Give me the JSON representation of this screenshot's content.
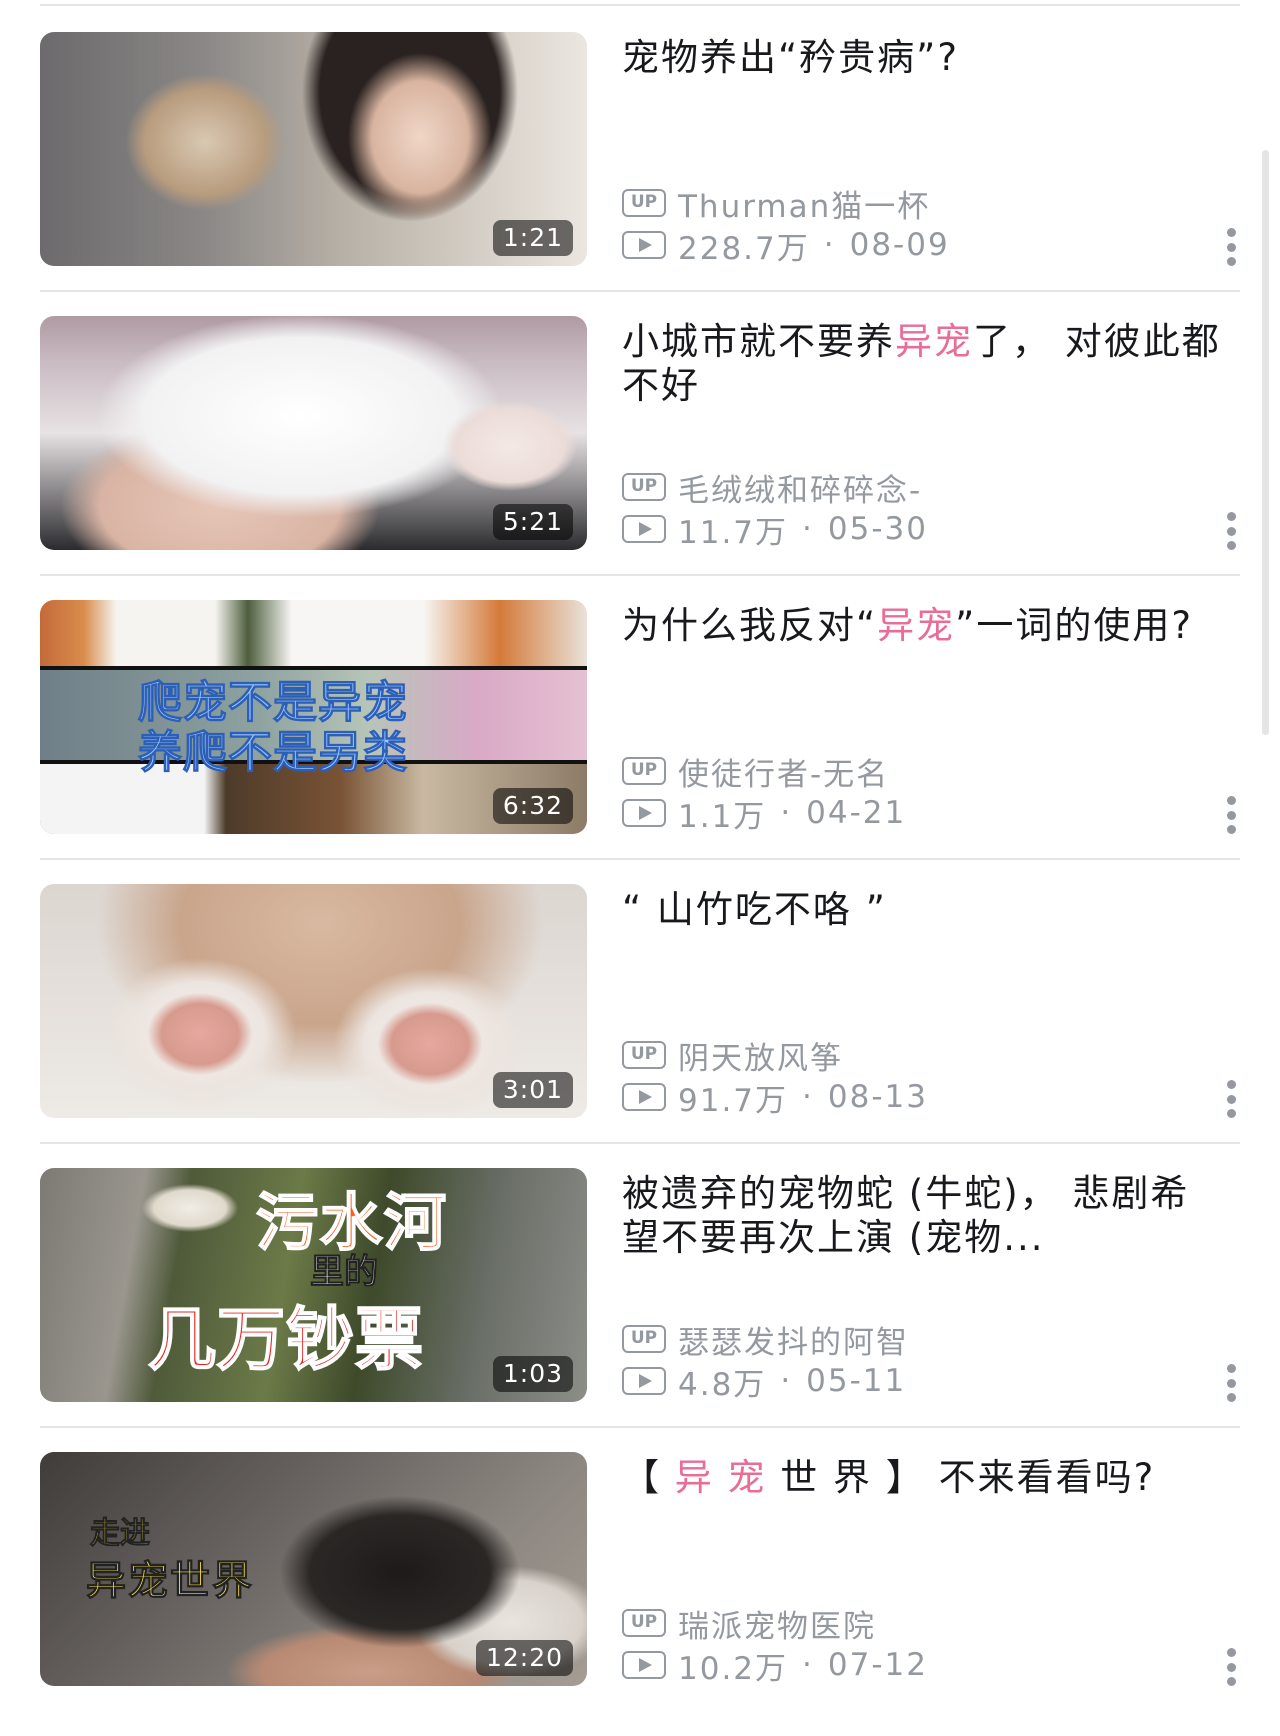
{
  "videos": [
    {
      "title_parts": [
        {
          "text": "宠物养出“矜贵病”?",
          "hl": false
        }
      ],
      "author": "Thurman猫一杯",
      "views": "228.7万",
      "date": "08-09",
      "duration": "1:21",
      "thumb_text": []
    },
    {
      "title_parts": [
        {
          "text": "小城市就不要养",
          "hl": false
        },
        {
          "text": "异宠",
          "hl": true
        },
        {
          "text": "了， 对彼此都不好",
          "hl": false
        }
      ],
      "author": "毛绒绒和碎碎念-",
      "views": "11.7万",
      "date": "05-30",
      "duration": "5:21",
      "thumb_text": []
    },
    {
      "title_parts": [
        {
          "text": "为什么我反对“",
          "hl": false
        },
        {
          "text": "异宠",
          "hl": true
        },
        {
          "text": "”一词的使用?",
          "hl": false
        }
      ],
      "author": "使徒行者-无名",
      "views": "1.1万",
      "date": "04-21",
      "duration": "6:32",
      "thumb_text": [
        "爬宠不是异宠",
        "养爬不是另类"
      ]
    },
    {
      "title_parts": [
        {
          "text": "“ 山竹吃不咯 ”",
          "hl": false
        }
      ],
      "author": "阴天放风筝",
      "views": "91.7万",
      "date": "08-13",
      "duration": "3:01",
      "thumb_text": []
    },
    {
      "title_parts": [
        {
          "text": "被遗弃的宠物蛇 (牛蛇)， 悲剧希望不要再次上演 (宠物...",
          "hl": false
        }
      ],
      "author": "瑟瑟发抖的阿智",
      "views": "4.8万",
      "date": "05-11",
      "duration": "1:03",
      "thumb_text": [
        "污水河",
        "里的",
        "几万钞票"
      ]
    },
    {
      "title_parts": [
        {
          "text": "【 ",
          "hl": false
        },
        {
          "text": "异 宠",
          "hl": true
        },
        {
          "text": " 世 界 】 不来看看吗?",
          "hl": false
        }
      ],
      "author": "瑞派宠物医院",
      "views": "10.2万",
      "date": "07-12",
      "duration": "12:20",
      "thumb_text": [
        "走进",
        "异宠世界"
      ]
    }
  ],
  "labels": {
    "up_badge": "UP",
    "dot_separator": "·"
  },
  "colors": {
    "highlight": "#e86e96",
    "meta": "#9499a0",
    "title": "#18191c",
    "divider": "#e3e5e7"
  }
}
